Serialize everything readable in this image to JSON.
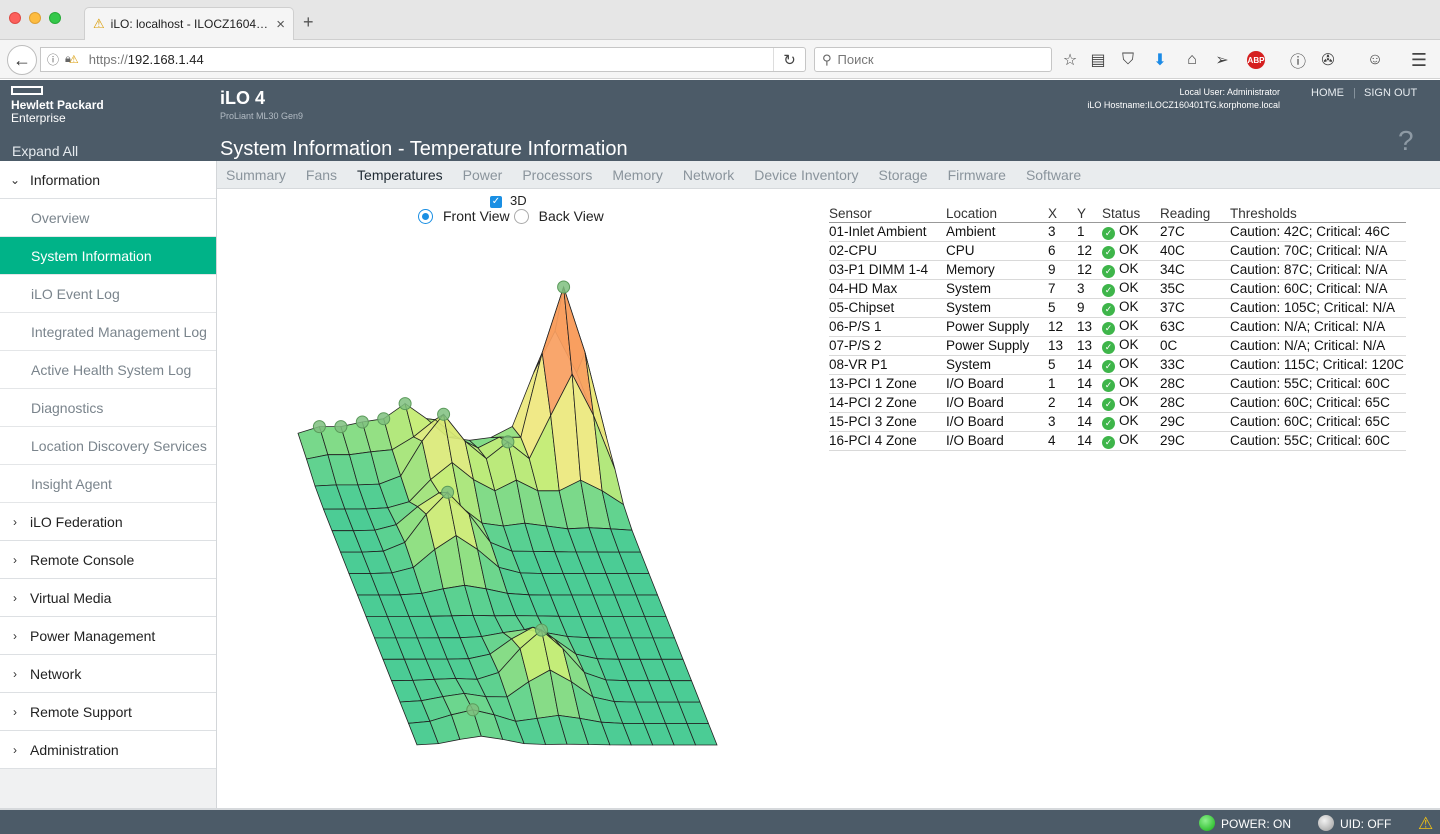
{
  "browser": {
    "tab_title": "iLO: localhost - ILOCZ1604…",
    "url_proto": "https://",
    "url_host": "192.168.1.44",
    "search_placeholder": "Поиск"
  },
  "header": {
    "brand_line1": "Hewlett Packard",
    "brand_line2": "Enterprise",
    "expand_all": "Expand All",
    "product": "iLO 4",
    "model": "ProLiant ML30 Gen9",
    "local_user": "Local User:  Administrator",
    "hostname": "iLO Hostname:ILOCZ160401TG.korphome.local",
    "home": "HOME",
    "sign_out": "SIGN OUT",
    "page_title": "System Information - Temperature Information",
    "help": "?"
  },
  "subtabs": [
    "Summary",
    "Fans",
    "Temperatures",
    "Power",
    "Processors",
    "Memory",
    "Network",
    "Device Inventory",
    "Storage",
    "Firmware",
    "Software"
  ],
  "active_subtab": "Temperatures",
  "sidebar": {
    "information": "Information",
    "sub_items": [
      "Overview",
      "System Information",
      "iLO Event Log",
      "Integrated Management Log",
      "Active Health System Log",
      "Diagnostics",
      "Location Discovery Services",
      "Insight Agent"
    ],
    "active_sub": "System Information",
    "groups": [
      "iLO Federation",
      "Remote Console",
      "Virtual Media",
      "Power Management",
      "Network",
      "Remote Support",
      "Administration"
    ]
  },
  "view": {
    "label_3d": "3D",
    "checked_3d": true,
    "front_view": "Front View",
    "back_view": "Back View",
    "selected": "Front View"
  },
  "table": {
    "headers": [
      "Sensor",
      "Location",
      "X",
      "Y",
      "Status",
      "Reading",
      "Thresholds"
    ],
    "rows": [
      [
        "01-Inlet Ambient",
        "Ambient",
        "3",
        "1",
        "OK",
        "27C",
        "Caution: 42C; Critical: 46C"
      ],
      [
        "02-CPU",
        "CPU",
        "6",
        "12",
        "OK",
        "40C",
        "Caution: 70C; Critical: N/A"
      ],
      [
        "03-P1 DIMM 1-4",
        "Memory",
        "9",
        "12",
        "OK",
        "34C",
        "Caution: 87C; Critical: N/A"
      ],
      [
        "04-HD Max",
        "System",
        "7",
        "3",
        "OK",
        "35C",
        "Caution: 60C; Critical: N/A"
      ],
      [
        "05-Chipset",
        "System",
        "5",
        "9",
        "OK",
        "37C",
        "Caution: 105C; Critical: N/A"
      ],
      [
        "06-P/S 1",
        "Power Supply",
        "12",
        "13",
        "OK",
        "63C",
        "Caution: N/A; Critical: N/A"
      ],
      [
        "07-P/S 2",
        "Power Supply",
        "13",
        "13",
        "OK",
        "0C",
        "Caution: N/A; Critical: N/A"
      ],
      [
        "08-VR P1",
        "System",
        "5",
        "14",
        "OK",
        "33C",
        "Caution: 115C; Critical: 120C"
      ],
      [
        "13-PCI 1 Zone",
        "I/O Board",
        "1",
        "14",
        "OK",
        "28C",
        "Caution: 55C; Critical: 60C"
      ],
      [
        "14-PCI 2 Zone",
        "I/O Board",
        "2",
        "14",
        "OK",
        "28C",
        "Caution: 60C; Critical: 65C"
      ],
      [
        "15-PCI 3 Zone",
        "I/O Board",
        "3",
        "14",
        "OK",
        "29C",
        "Caution: 60C; Critical: 65C"
      ],
      [
        "16-PCI 4 Zone",
        "I/O Board",
        "4",
        "14",
        "OK",
        "29C",
        "Caution: 55C; Critical: 60C"
      ]
    ]
  },
  "footer": {
    "power": "POWER: ON",
    "uid": "UID: OFF"
  },
  "colors": {
    "accent": "#00b388",
    "header_bg": "#4c5b68",
    "ok_green": "#3eb54a",
    "check_blue": "#1a8fe3"
  },
  "icons": {
    "back": "back-arrow-icon",
    "reload": "reload-icon",
    "search": "search-icon",
    "bookmark": "star-icon",
    "help": "question-icon",
    "status_ok": "check-circle-icon",
    "warning": "warning-icon"
  }
}
